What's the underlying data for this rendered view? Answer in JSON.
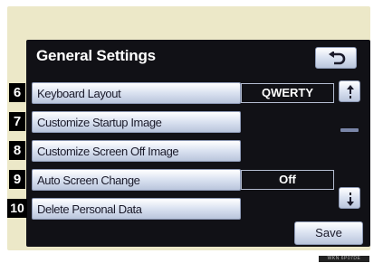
{
  "screen": {
    "title": "General Settings"
  },
  "items": [
    {
      "number": "6",
      "label": "Keyboard Layout",
      "value": "QWERTY"
    },
    {
      "number": "7",
      "label": "Customize Startup Image"
    },
    {
      "number": "8",
      "label": "Customize Screen Off Image"
    },
    {
      "number": "9",
      "label": "Auto Screen Change",
      "value": "Off"
    },
    {
      "number": "10",
      "label": "Delete Personal Data"
    }
  ],
  "footer": {
    "save_label": "Save"
  },
  "watermark": "WKN 6P07DE",
  "icons": {
    "back": "return-arrow-icon",
    "scroll_up": "scroll-up-icon",
    "scroll_down": "scroll-down-icon"
  },
  "colors": {
    "bezel": "#ece8c8",
    "screen_background": "#111116",
    "button_light": "#dde4f2",
    "button_border": "#8e9ab6"
  }
}
